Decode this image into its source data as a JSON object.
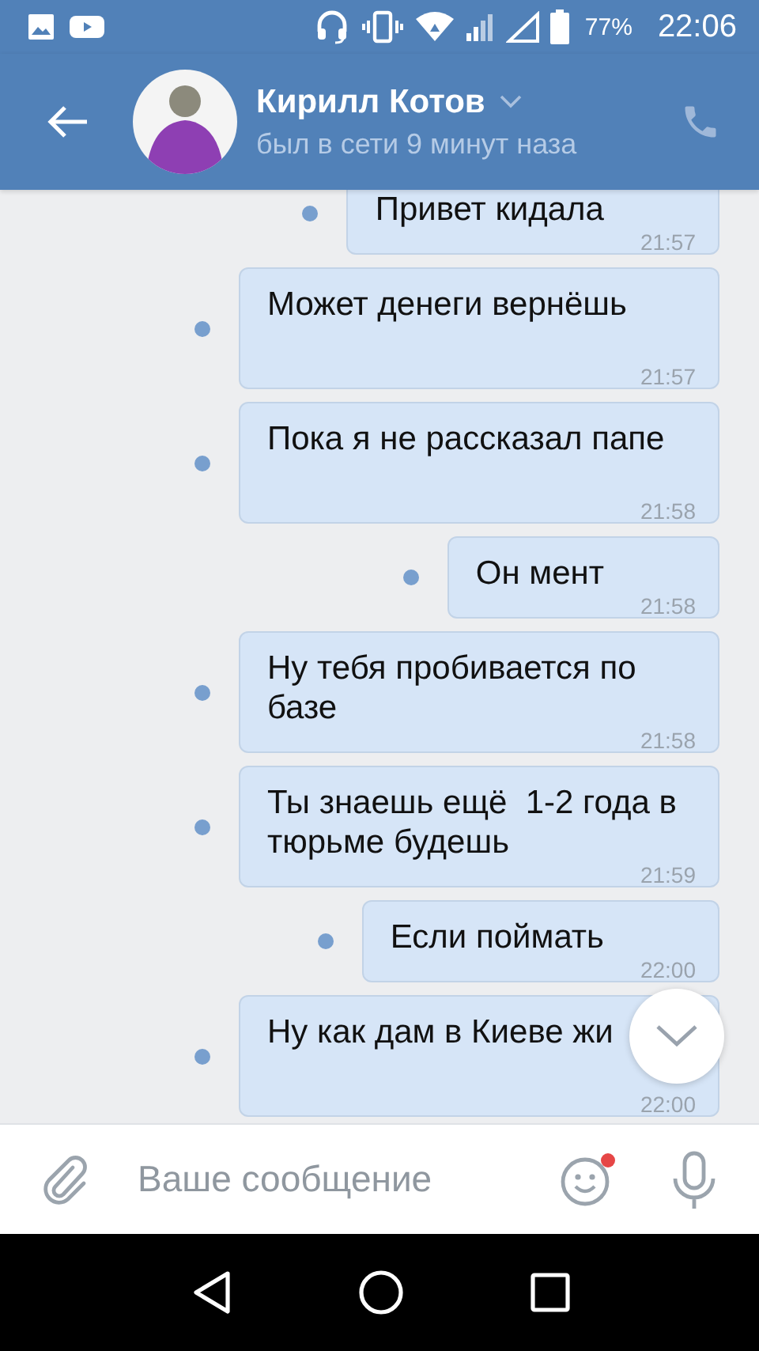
{
  "status_bar": {
    "battery": "77%",
    "time": "22:06"
  },
  "header": {
    "name": "Кирилл Котов",
    "status": "был в сети 9 минут наза"
  },
  "messages": [
    {
      "text": "Привет кидала",
      "time": "21:57",
      "unread": true
    },
    {
      "text": "Может денеги вернёшь",
      "time": "21:57",
      "unread": true
    },
    {
      "text": "Пока я не рассказал папе",
      "time": "21:58",
      "unread": true
    },
    {
      "text": "Он мент",
      "time": "21:58",
      "unread": true
    },
    {
      "text": "Ну тебя пробивается по базе",
      "time": "21:58",
      "unread": true
    },
    {
      "text": "Ты знаешь ещё  1-2 года в тюрьме будешь",
      "time": "21:59",
      "unread": true
    },
    {
      "text": "Если поймать",
      "time": "22:00",
      "unread": true
    },
    {
      "text": "Ну как дам в Киеве жи",
      "time": "22:00",
      "unread": true
    }
  ],
  "composer": {
    "placeholder": "Ваше сообщение",
    "emoji_new": true
  }
}
